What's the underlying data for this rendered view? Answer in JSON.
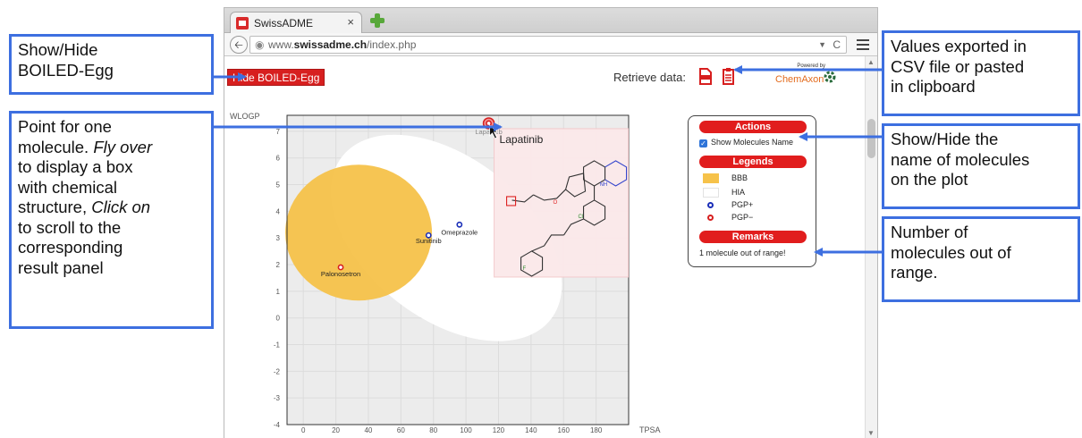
{
  "browser": {
    "tab_title": "SwissADME",
    "tab_close": "×",
    "url_prefix": "www.",
    "url_domain": "swissadme.ch",
    "url_path": "/index.php",
    "back_icon": "left-arrow-icon",
    "reload_glyph": "C"
  },
  "page": {
    "hide_button": "Hide BOILED-Egg",
    "retrieve_label": "Retrieve data:",
    "powered_by": "Powered by",
    "chemaxon": "ChemAxon"
  },
  "panel": {
    "actions_header": "Actions",
    "show_names_label": "Show Molecules Name",
    "legends_header": "Legends",
    "legend_items": [
      "BBB",
      "HIA",
      "PGP+",
      "PGP−"
    ],
    "remarks_header": "Remarks",
    "remarks_text": "1 molecule out of range!"
  },
  "callouts": {
    "show_hide_egg": [
      "Show/Hide",
      "BOILED-Egg"
    ],
    "point_for_one": {
      "l1": "Point for one",
      "l2_pre": "molecule. ",
      "l2_em": "Fly over",
      "l3": "to display a box",
      "l4": "with chemical",
      "l5_pre": "structure, ",
      "l5_em": "Click on",
      "l6": "to scroll to the",
      "l7": "corresponding",
      "l8": "result panel"
    },
    "values_exported": [
      "Values exported in",
      "CSV file or pasted",
      "in clipboard"
    ],
    "show_hide_names": [
      "Show/Hide the",
      "name of molecules",
      "on the plot"
    ],
    "number_out": [
      "Number of",
      "molecules out of",
      "range."
    ]
  },
  "colors": {
    "accent_red": "#d71f1f",
    "callout_blue": "#3d6fe0",
    "yolk": "#f6c24a",
    "pgp_plus": "#1b2fb8",
    "pgp_minus": "#d71f1f"
  },
  "chart_data": {
    "type": "scatter",
    "ylabel": "WLOGP",
    "xlabel": "TPSA",
    "xlim": [
      -10,
      200
    ],
    "ylim": [
      -4,
      7.6
    ],
    "x_ticks": [
      0,
      20,
      40,
      60,
      80,
      100,
      120,
      140,
      160,
      180
    ],
    "y_ticks": [
      -4,
      -3,
      -2,
      -1,
      0,
      1,
      2,
      3,
      4,
      5,
      6,
      7
    ],
    "grid": true,
    "points": [
      {
        "name": "Palonosetron",
        "x": 23,
        "y": 1.9,
        "class": "PGP-"
      },
      {
        "name": "Sunitinib",
        "x": 77,
        "y": 3.1,
        "class": "PGP+"
      },
      {
        "name": "Omeprazole",
        "x": 96,
        "y": 3.5,
        "class": "PGP+"
      },
      {
        "name": "Lapatinib",
        "x": 114,
        "y": 7.3,
        "class": "PGP-"
      }
    ],
    "tooltip_title": "Lapatinib"
  }
}
